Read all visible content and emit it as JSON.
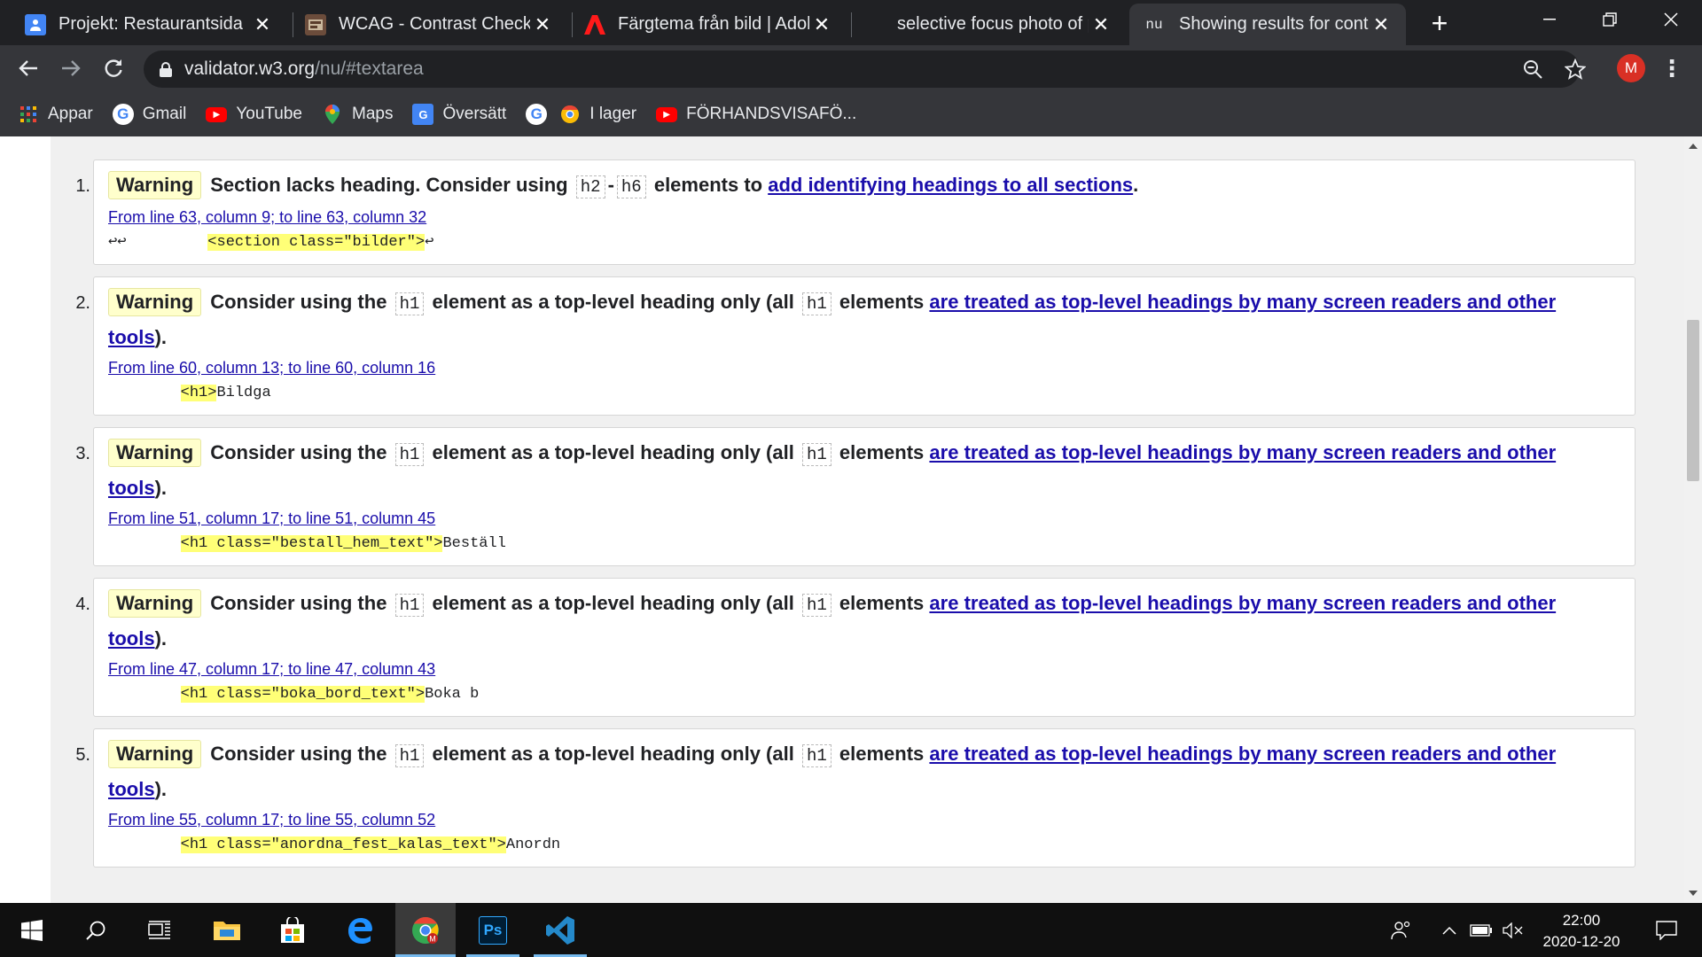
{
  "tabs": [
    {
      "title": "Projekt: Restaurantsida",
      "favicon": "person-icon",
      "color": "#4285f4"
    },
    {
      "title": "WCAG - Contrast Checker",
      "favicon": "webaim-icon",
      "color": "#6b4c3b"
    },
    {
      "title": "Färgtema från bild | Adobe",
      "favicon": "adobe-icon",
      "color": "#ff0000"
    },
    {
      "title": "selective focus photo of pin",
      "favicon": "unsplash-icon",
      "color": "#202124"
    },
    {
      "title": "Showing results for content",
      "favicon": "nu-icon",
      "color": "#35363a",
      "favicon_text": "nu"
    }
  ],
  "omnibox": {
    "host": "validator.w3.org",
    "path": "/nu/#textarea"
  },
  "profile_initial": "M",
  "bookmarks": [
    {
      "label": "Appar",
      "icon": "apps-grid-icon"
    },
    {
      "label": "Gmail",
      "icon": "google-icon"
    },
    {
      "label": "YouTube",
      "icon": "youtube-icon"
    },
    {
      "label": "Maps",
      "icon": "maps-icon"
    },
    {
      "label": "Översätt",
      "icon": "translate-icon"
    },
    {
      "label": "",
      "icon": "google-icon"
    },
    {
      "label": "I lager",
      "icon": "chrome-icon"
    },
    {
      "label": "FÖRHANDSVISAFÖ...",
      "icon": "youtube-icon"
    }
  ],
  "messages": [
    {
      "num": "1.",
      "type": "Warning",
      "text_before": "Section lacks heading. Consider using",
      "code1": "h2",
      "dash": "-",
      "code2": "h6",
      "text_after": "elements to",
      "link": "add identifying headings to all sections",
      "end": ".",
      "location": "From line 63, column 9; to line 63, column 32",
      "extract_pre": "↩↩         ",
      "extract_hl": "<section class=\"bilder\">",
      "extract_post": "↩"
    },
    {
      "num": "2.",
      "type": "Warning",
      "text_before": "Consider using the",
      "code1": "h1",
      "text_mid": "element as a top-level heading only (all",
      "code2": "h1",
      "text_after": "elements",
      "link_a": "are treated as top-level headings by many screen readers and other",
      "link_b": "tools",
      "end": ").",
      "location": "From line 60, column 13; to line 60, column 16",
      "extract_pre": "        ",
      "extract_hl": "<h1>",
      "extract_post": "Bildga"
    },
    {
      "num": "3.",
      "type": "Warning",
      "text_before": "Consider using the",
      "code1": "h1",
      "text_mid": "element as a top-level heading only (all",
      "code2": "h1",
      "text_after": "elements",
      "link_a": "are treated as top-level headings by many screen readers and other",
      "link_b": "tools",
      "end": ").",
      "location": "From line 51, column 17; to line 51, column 45",
      "extract_pre": "        ",
      "extract_hl": "<h1 class=\"bestall_hem_text\">",
      "extract_post": "Beställ"
    },
    {
      "num": "4.",
      "type": "Warning",
      "text_before": "Consider using the",
      "code1": "h1",
      "text_mid": "element as a top-level heading only (all",
      "code2": "h1",
      "text_after": "elements",
      "link_a": "are treated as top-level headings by many screen readers and other",
      "link_b": "tools",
      "end": ").",
      "location": "From line 47, column 17; to line 47, column 43",
      "extract_pre": "        ",
      "extract_hl": "<h1 class=\"boka_bord_text\">",
      "extract_post": "Boka b"
    },
    {
      "num": "5.",
      "type": "Warning",
      "text_before": "Consider using the",
      "code1": "h1",
      "text_mid": "element as a top-level heading only (all",
      "code2": "h1",
      "text_after": "elements",
      "link_a": "are treated as top-level headings by many screen readers and other",
      "link_b": "tools",
      "end": ").",
      "location": "From line 55, column 17; to line 55, column 52",
      "extract_pre": "        ",
      "extract_hl": "<h1 class=\"anordna_fest_kalas_text\">",
      "extract_post": "Anordn"
    }
  ],
  "taskbar": {
    "apps": [
      {
        "name": "start",
        "icon": "windows-icon"
      },
      {
        "name": "search",
        "icon": "search-icon"
      },
      {
        "name": "task-view",
        "icon": "task-view-icon"
      },
      {
        "name": "file-explorer",
        "icon": "folder-icon"
      },
      {
        "name": "store",
        "icon": "store-icon"
      },
      {
        "name": "edge",
        "icon": "edge-icon"
      },
      {
        "name": "chrome",
        "icon": "chrome-icon"
      },
      {
        "name": "photoshop",
        "icon": "photoshop-icon",
        "label": "Ps"
      },
      {
        "name": "vscode",
        "icon": "vscode-icon"
      }
    ],
    "time": "22:00",
    "date": "2020-12-20"
  }
}
